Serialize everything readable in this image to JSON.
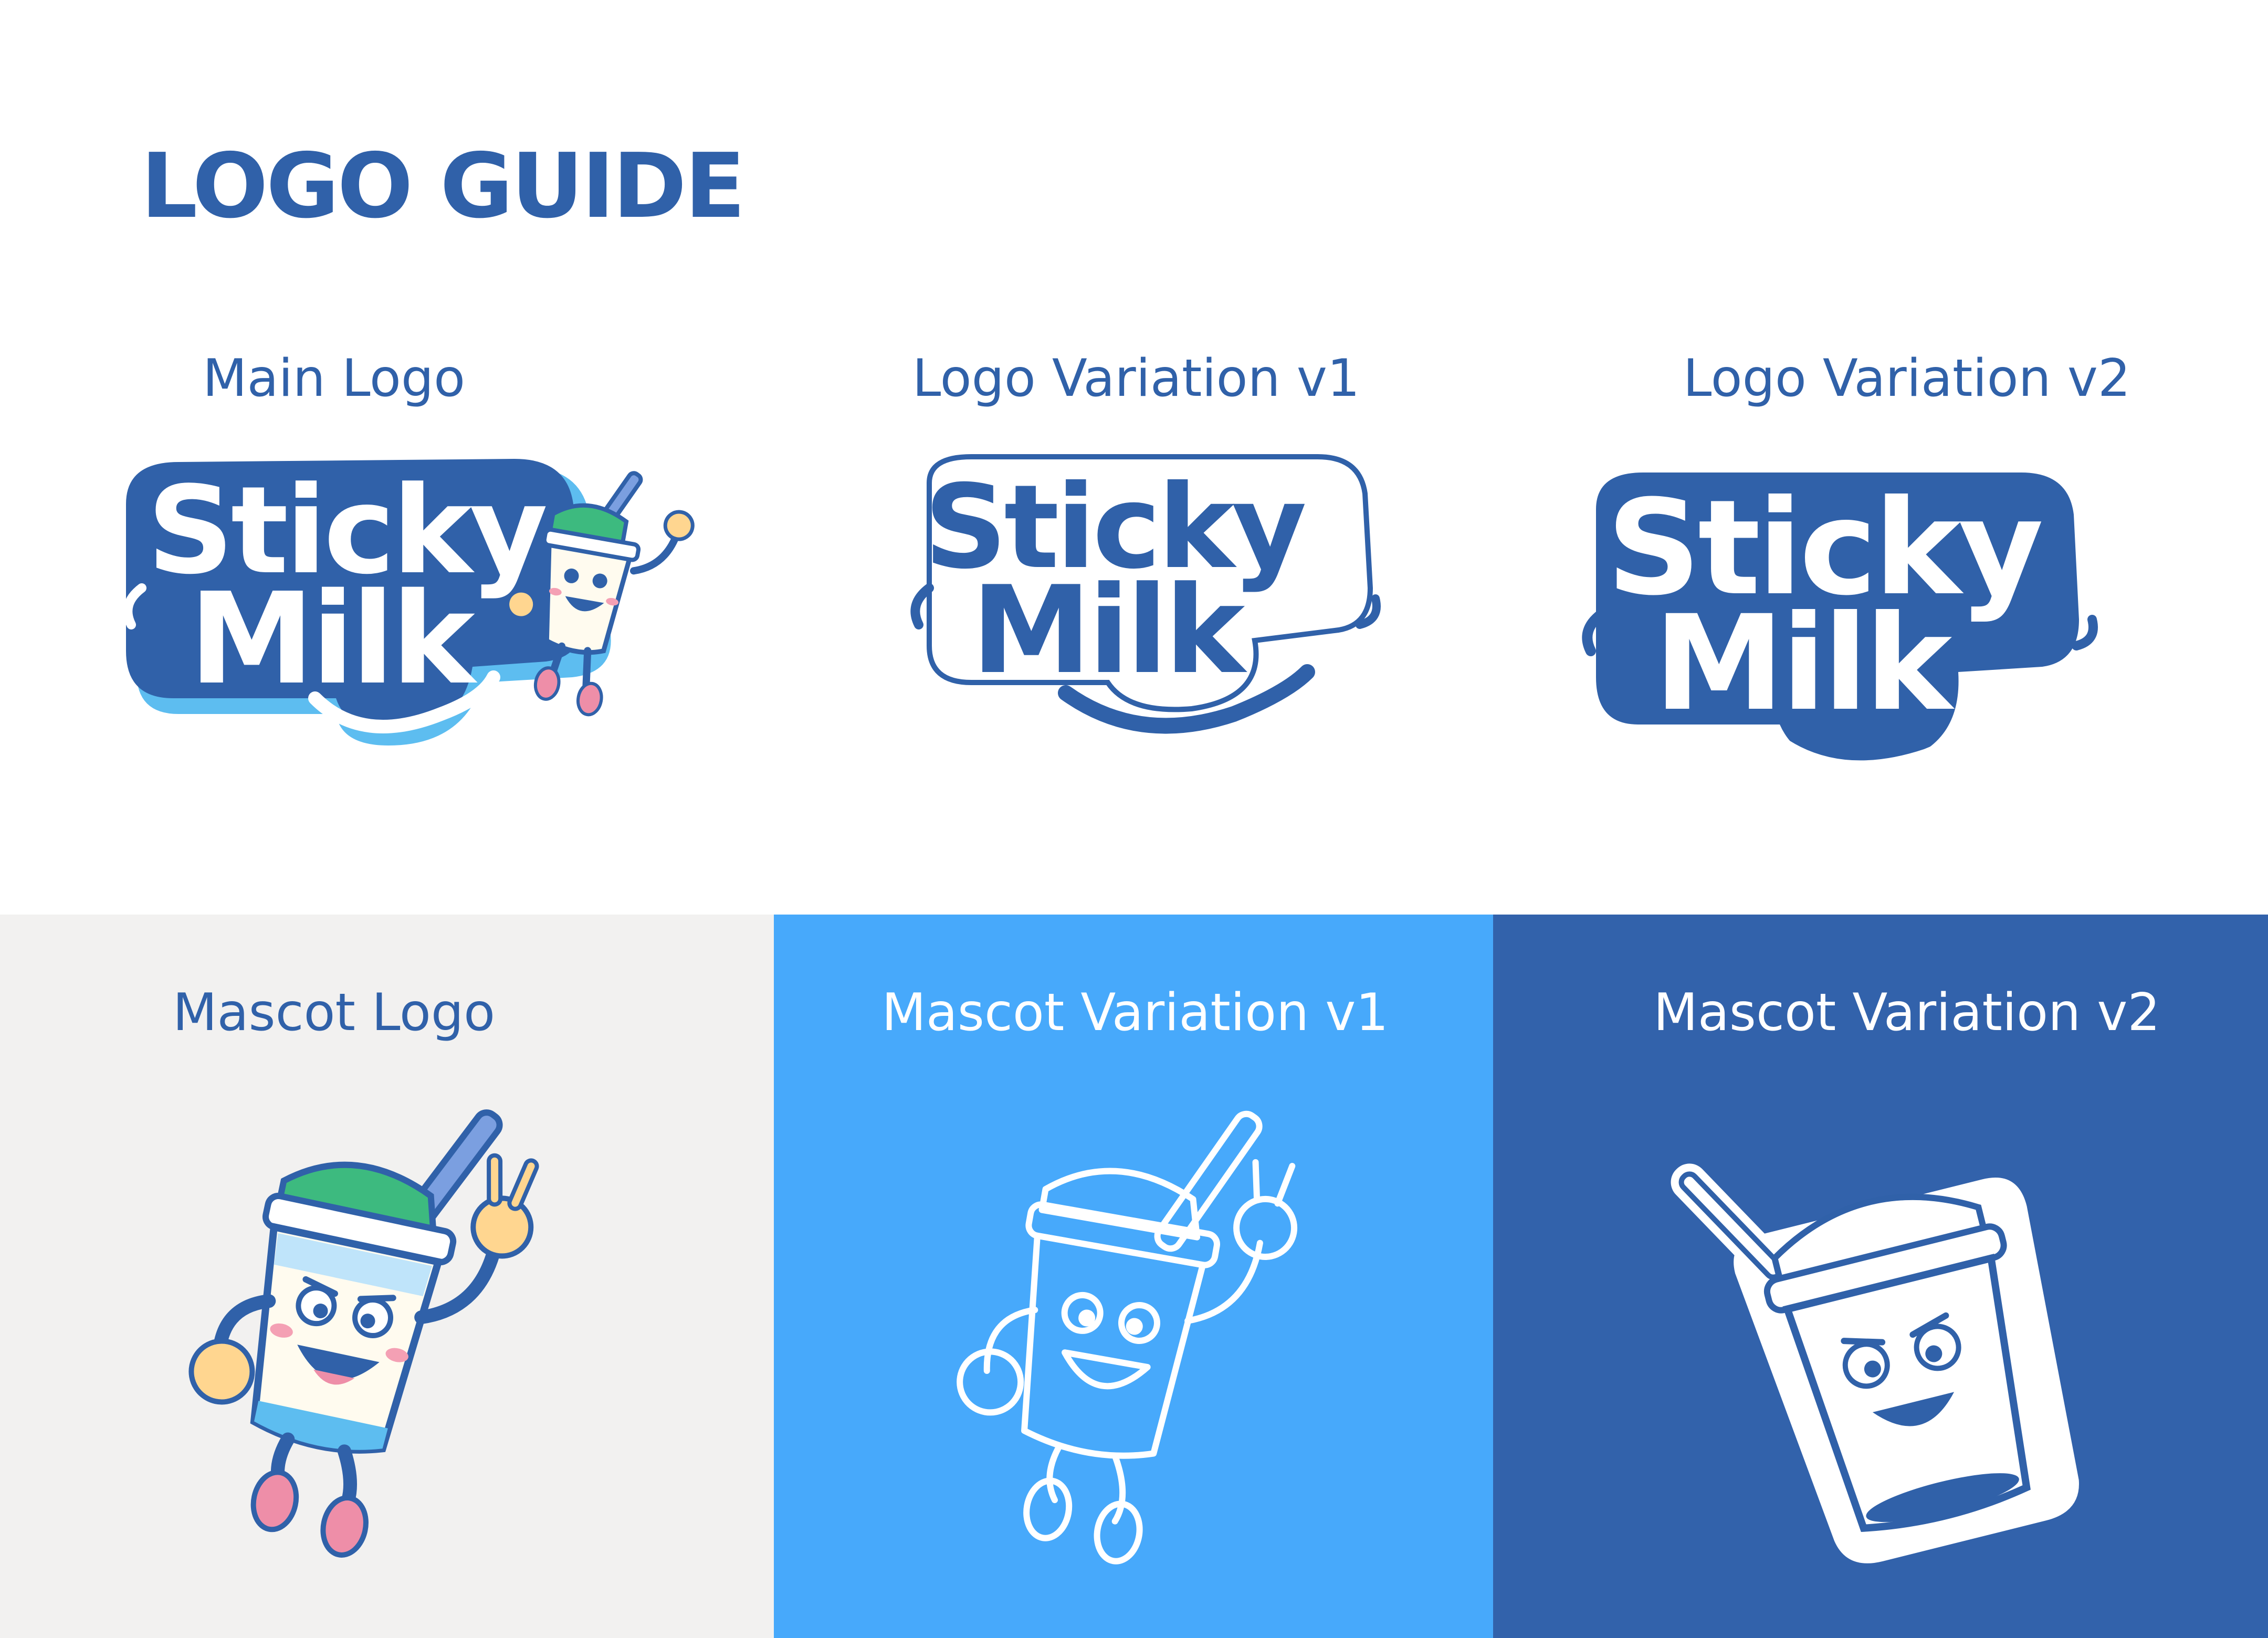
{
  "page": {
    "title": "LOGO GUIDE",
    "background": "#FFFFFF",
    "accent": "#3061A9"
  },
  "logos": [
    {
      "label": "Main  Logo",
      "wordmark": [
        "Sticky",
        "Milk"
      ],
      "style": "full-color-with-mascot"
    },
    {
      "label": "Logo Variation v1",
      "wordmark": [
        "Sticky",
        "Milk"
      ],
      "style": "blue-fill"
    },
    {
      "label": "Logo Variation v2",
      "wordmark": [
        "Sticky",
        "Milk"
      ],
      "style": "white-fill-blue-outline"
    }
  ],
  "mascots": [
    {
      "label": "Mascot Logo",
      "panel_color": "#F2F1F0",
      "label_color": "#3061A9",
      "style": "full-color"
    },
    {
      "label": "Mascot Variation v1",
      "panel_color": "#47A9FB",
      "label_color": "#FFFFFF",
      "style": "white-outline"
    },
    {
      "label": "Mascot Variation v2",
      "panel_color": "#3262AB",
      "label_color": "#FFFFFF",
      "style": "cup-sticker"
    }
  ],
  "colors": {
    "navy": "#3061A9",
    "sky": "#47A9FB",
    "light_blue": "#5DBDF0",
    "cap_green": "#3DBA7F",
    "skin": "#FFD690",
    "shoe_pink": "#EE8EA8",
    "cream": "#FFFBEF"
  }
}
